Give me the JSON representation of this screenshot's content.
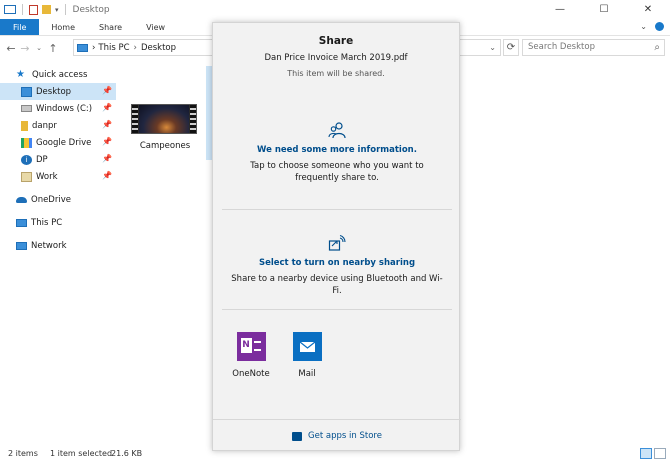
{
  "window": {
    "title": "Desktop",
    "controls": [
      "—",
      "☐",
      "✕"
    ]
  },
  "ribbon": {
    "tabs": [
      "File",
      "Home",
      "Share",
      "View"
    ]
  },
  "address": {
    "crumbs": [
      "This PC",
      "Desktop"
    ],
    "separator": "›",
    "search_placeholder": "Search Desktop"
  },
  "nav": {
    "quick_access": "Quick access",
    "items": [
      {
        "label": "Desktop",
        "icon": "desktop-icon",
        "pinned": true
      },
      {
        "label": "Windows (C:)",
        "icon": "drive-icon",
        "pinned": true
      },
      {
        "label": "danpr",
        "icon": "folder-icon",
        "pinned": true
      },
      {
        "label": "Google Drive",
        "icon": "google-drive-icon",
        "pinned": true
      },
      {
        "label": "DP",
        "icon": "info-icon",
        "pinned": true
      },
      {
        "label": "Work",
        "icon": "folder-check-icon",
        "pinned": true
      }
    ],
    "onedrive": "OneDrive",
    "this_pc": "This PC",
    "network": "Network"
  },
  "files": [
    {
      "name": "Campeones",
      "type": "video"
    }
  ],
  "status": {
    "items": "2 items",
    "selected": "1 item selected",
    "size": "21.6 KB"
  },
  "share": {
    "title": "Share",
    "file_name": "Dan Price Invoice March 2019.pdf",
    "note": "This item will be shared.",
    "contacts": {
      "title": "We need some more information.",
      "body": "Tap to choose someone who you want to frequently share to."
    },
    "nearby": {
      "title": "Select to turn on nearby sharing",
      "body": "Share to a nearby device using Bluetooth and Wi-Fi."
    },
    "apps": [
      {
        "name": "OneNote",
        "color": "#7b2d9e"
      },
      {
        "name": "Mail",
        "color": "#0a6fc2"
      }
    ],
    "store_link": "Get apps in Store"
  },
  "colors": {
    "accent": "#1979ca",
    "share_link": "#004e8c",
    "selection": "#cce4f7"
  }
}
